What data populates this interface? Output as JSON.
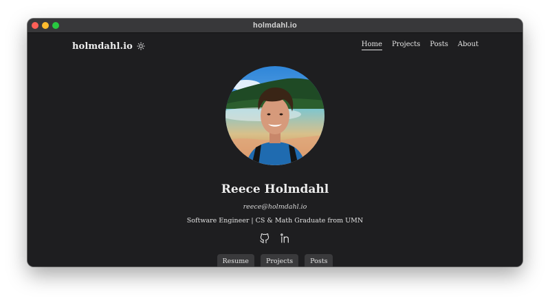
{
  "window": {
    "title": "holmdahl.io",
    "traffic_lights": [
      "#fe5f57",
      "#febc2e",
      "#28c840"
    ]
  },
  "header": {
    "brand": "holmdahl.io",
    "theme_toggle_icon": "sun-icon",
    "nav": [
      {
        "label": "Home",
        "active": true
      },
      {
        "label": "Projects",
        "active": false
      },
      {
        "label": "Posts",
        "active": false
      },
      {
        "label": "About",
        "active": false
      }
    ]
  },
  "profile": {
    "avatar": "profile-photo",
    "name": "Reece Holmdahl",
    "email": "reece@holmdahl.io",
    "tagline": "Software Engineer | CS & Math Graduate from UMN",
    "social_icons": [
      "github-icon",
      "linkedin-icon"
    ]
  },
  "buttons": [
    "Resume",
    "Projects",
    "Posts"
  ],
  "colors": {
    "background": "#1e1e20",
    "titlebar": "#38383a",
    "button_bg": "#3a3a3c",
    "text": "#ececec"
  }
}
